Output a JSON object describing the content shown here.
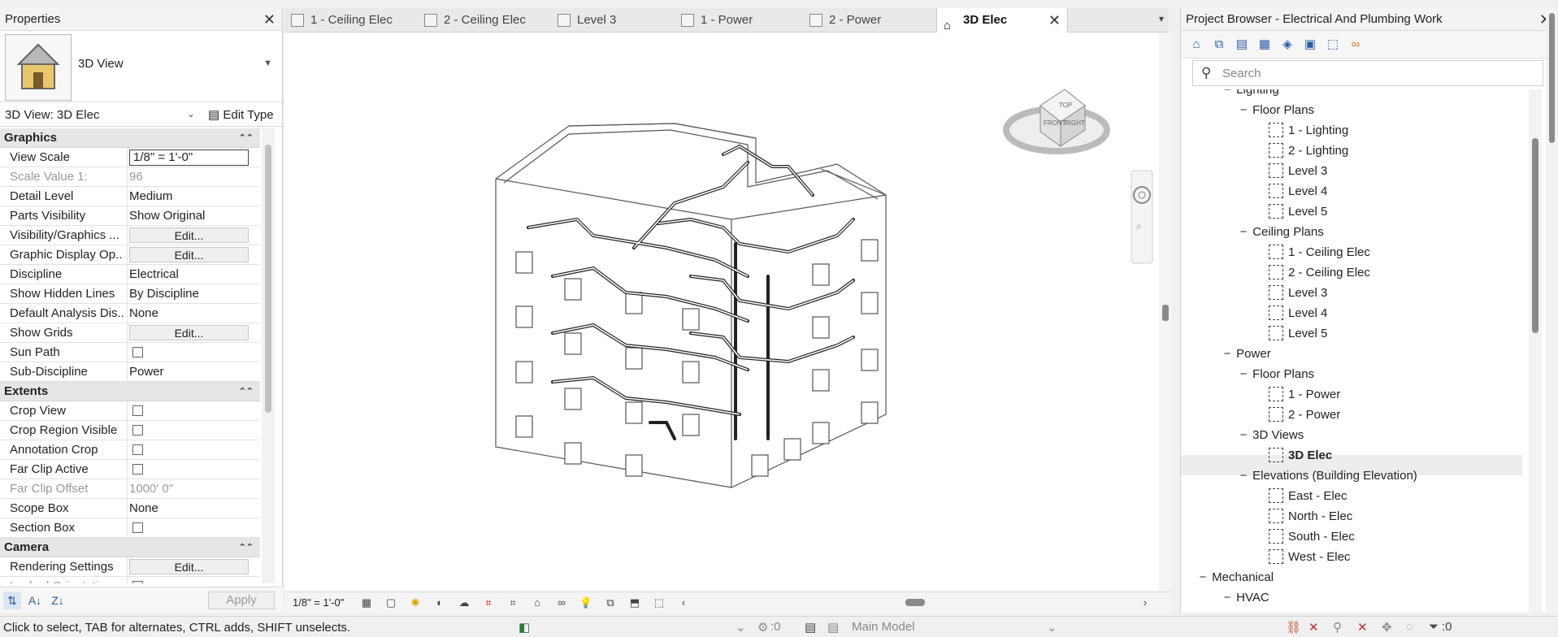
{
  "properties": {
    "title": "Properties",
    "type_name": "3D View",
    "instance_selector": "3D View: 3D Elec",
    "edit_type": "Edit Type",
    "groups": {
      "graphics": "Graphics",
      "extents": "Extents",
      "camera": "Camera"
    },
    "rows": {
      "view_scale": {
        "k": "View Scale",
        "v": "1/8\" = 1'-0\""
      },
      "scale_value": {
        "k": "Scale Value    1:",
        "v": "96"
      },
      "detail_level": {
        "k": "Detail Level",
        "v": "Medium"
      },
      "parts_visibility": {
        "k": "Parts Visibility",
        "v": "Show Original"
      },
      "vis_graphics": {
        "k": "Visibility/Graphics ...",
        "v": "Edit..."
      },
      "graphic_display": {
        "k": "Graphic Display Op...",
        "v": "Edit..."
      },
      "discipline": {
        "k": "Discipline",
        "v": "Electrical"
      },
      "show_hidden": {
        "k": "Show Hidden Lines",
        "v": "By Discipline"
      },
      "default_analysis": {
        "k": "Default Analysis Dis...",
        "v": "None"
      },
      "show_grids": {
        "k": "Show Grids",
        "v": "Edit..."
      },
      "sun_path": {
        "k": "Sun Path"
      },
      "sub_discipline": {
        "k": "Sub-Discipline",
        "v": "Power"
      },
      "crop_view": {
        "k": "Crop View"
      },
      "crop_region": {
        "k": "Crop Region Visible"
      },
      "annotation_crop": {
        "k": "Annotation Crop"
      },
      "far_clip_active": {
        "k": "Far Clip Active"
      },
      "far_clip_offset": {
        "k": "Far Clip Offset",
        "v": "1000'  0\""
      },
      "scope_box": {
        "k": "Scope Box",
        "v": "None"
      },
      "section_box": {
        "k": "Section Box"
      },
      "rendering_settings": {
        "k": "Rendering Settings",
        "v": "Edit..."
      },
      "locked_orientation": {
        "k": "Locked Orientation"
      }
    },
    "apply": "Apply"
  },
  "tabs": [
    {
      "label": "1 - Ceiling Elec"
    },
    {
      "label": "2 - Ceiling Elec"
    },
    {
      "label": "Level 3"
    },
    {
      "label": "1 - Power"
    },
    {
      "label": "2 - Power"
    },
    {
      "label": "3D Elec"
    }
  ],
  "viewcube": {
    "top": "TOP",
    "front": "FRONT",
    "right": "RIGHT"
  },
  "viewbar": {
    "scale": "1/8\" = 1'-0\""
  },
  "project_browser": {
    "title": "Project Browser - Electrical And Plumbing Work",
    "search_placeholder": "Search",
    "tree": [
      {
        "label": "Lighting",
        "level": 2,
        "type": "group"
      },
      {
        "label": "Floor Plans",
        "level": 3,
        "type": "group"
      },
      {
        "label": "1 - Lighting",
        "level": 4,
        "type": "view"
      },
      {
        "label": "2 - Lighting",
        "level": 4,
        "type": "view"
      },
      {
        "label": "Level 3",
        "level": 4,
        "type": "view"
      },
      {
        "label": "Level 4",
        "level": 4,
        "type": "view"
      },
      {
        "label": "Level 5",
        "level": 4,
        "type": "view"
      },
      {
        "label": "Ceiling Plans",
        "level": 3,
        "type": "group"
      },
      {
        "label": "1 - Ceiling Elec",
        "level": 4,
        "type": "view"
      },
      {
        "label": "2 - Ceiling Elec",
        "level": 4,
        "type": "view"
      },
      {
        "label": "Level 3",
        "level": 4,
        "type": "view"
      },
      {
        "label": "Level 4",
        "level": 4,
        "type": "view"
      },
      {
        "label": "Level 5",
        "level": 4,
        "type": "view"
      },
      {
        "label": "Power",
        "level": 2,
        "type": "group"
      },
      {
        "label": "Floor Plans",
        "level": 3,
        "type": "group"
      },
      {
        "label": "1 - Power",
        "level": 4,
        "type": "view"
      },
      {
        "label": "2 - Power",
        "level": 4,
        "type": "view"
      },
      {
        "label": "3D Views",
        "level": 3,
        "type": "group"
      },
      {
        "label": "3D Elec",
        "level": 4,
        "type": "view",
        "selected": true
      },
      {
        "label": "Elevations (Building Elevation)",
        "level": 3,
        "type": "group"
      },
      {
        "label": "East - Elec",
        "level": 4,
        "type": "view"
      },
      {
        "label": "North - Elec",
        "level": 4,
        "type": "view"
      },
      {
        "label": "South - Elec",
        "level": 4,
        "type": "view"
      },
      {
        "label": "West - Elec",
        "level": 4,
        "type": "view"
      },
      {
        "label": "Mechanical",
        "level": 1,
        "type": "group"
      },
      {
        "label": "HVAC",
        "level": 2,
        "type": "group"
      }
    ]
  },
  "status": {
    "message": "Click to select, TAB for alternates, CTRL adds, SHIFT unselects.",
    "workset_count": ":0",
    "model": "Main Model",
    "filter_count": ":0"
  }
}
